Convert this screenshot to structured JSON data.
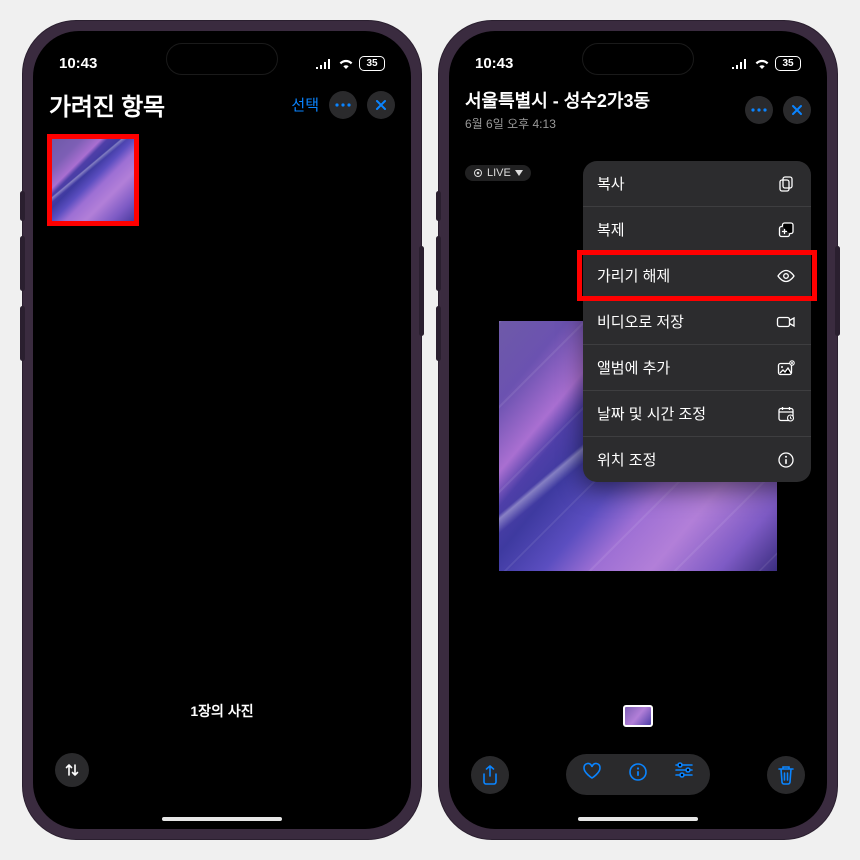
{
  "status": {
    "time": "10:43",
    "battery": "35"
  },
  "left": {
    "title": "가려진 항목",
    "select_label": "선택",
    "footer": "1장의 사진"
  },
  "right": {
    "title": "서울특별시 - 성수2가3동",
    "subtitle": "6월 6일 오후 4:13",
    "live_label": "LIVE",
    "menu": {
      "copy": "복사",
      "duplicate": "복제",
      "unhide": "가리기 해제",
      "save_video": "비디오로 저장",
      "add_album": "앨범에 추가",
      "adjust_dt": "날짜 및 시간 조정",
      "adjust_loc": "위치 조정"
    }
  }
}
